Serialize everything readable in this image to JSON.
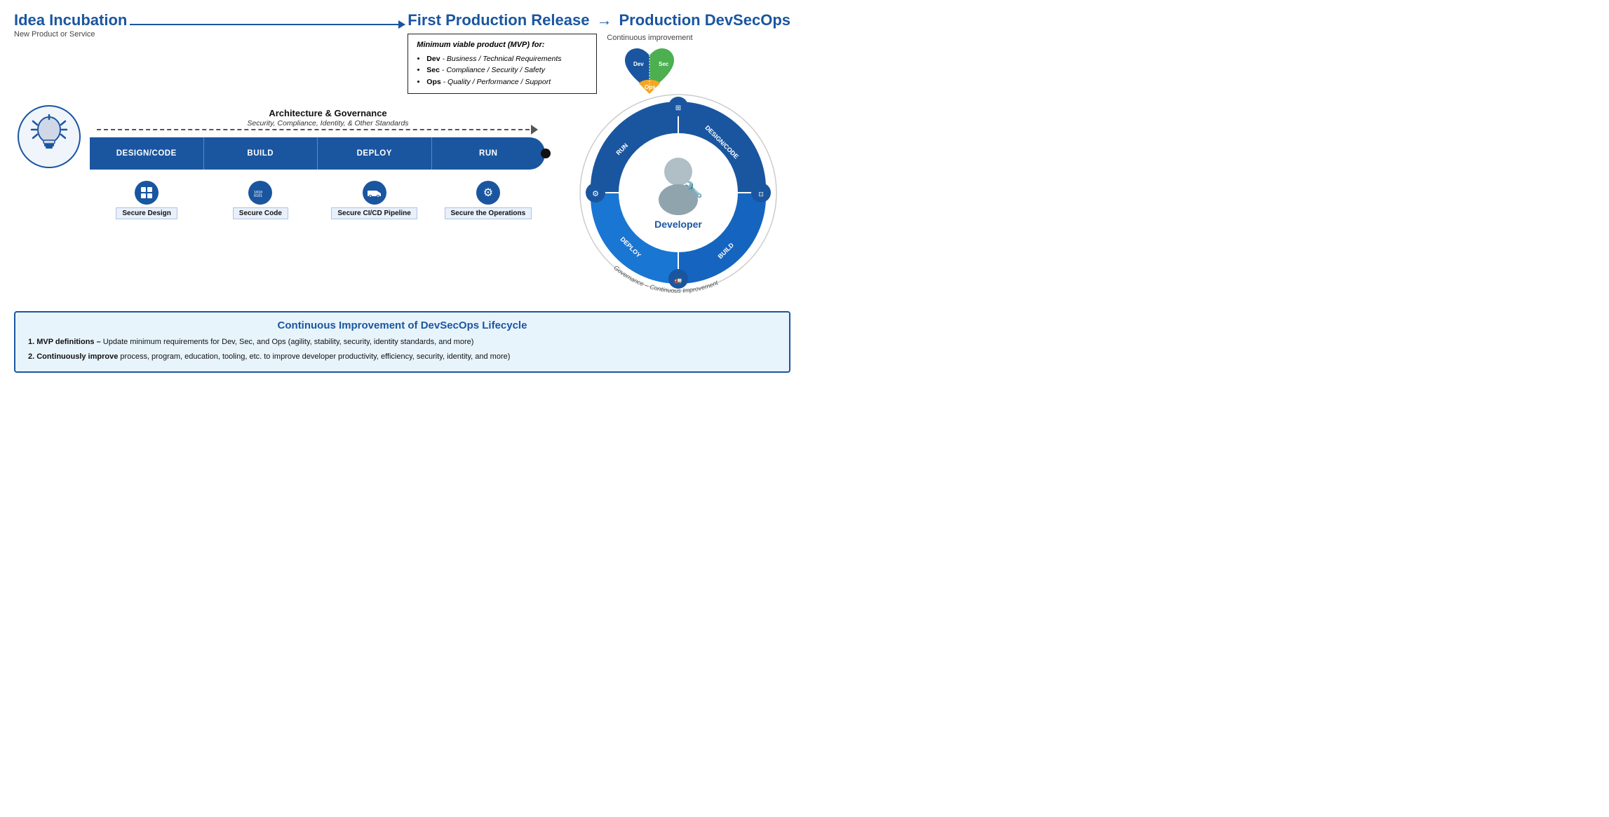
{
  "header": {
    "idea_title": "Idea Incubation",
    "idea_subtitle": "New Product or Service",
    "first_production": "First Production Release",
    "arrow": "→",
    "production_devsecops": "Production DevSecOps",
    "continuous_improvement": "Continuous improvement"
  },
  "mvp": {
    "title": "Minimum viable product (MVP) for:",
    "items": [
      {
        "label": "Dev",
        "desc": "Business / Technical Requirements"
      },
      {
        "label": "Sec",
        "desc": "Compliance / Security / Safety"
      },
      {
        "label": "Ops",
        "desc": "Quality / Performance / Support"
      }
    ]
  },
  "architecture": {
    "title": "Architecture & Governance",
    "subtitle": "Security, Compliance, Identity, & Other Standards"
  },
  "pipeline": {
    "stages": [
      "DESIGN/CODE",
      "BUILD",
      "DEPLOY",
      "RUN"
    ],
    "icons": [
      {
        "label": "Secure Design",
        "icon": "⊞"
      },
      {
        "label": "Secure Code",
        "icon": "⊞"
      },
      {
        "label": "Secure CI/CD Pipeline",
        "icon": "🚛"
      },
      {
        "label": "Secure the Operations",
        "icon": "⚙"
      }
    ]
  },
  "circle": {
    "stages": [
      "DESIGN/CODE",
      "BUILD",
      "DEPLOY",
      "RUN"
    ],
    "center_label": "Developer",
    "governance_label": "Governance – Continuous Improvement"
  },
  "bottom": {
    "title": "Continuous Improvement of DevSecOps Lifecycle",
    "point1_bold": "1.  MVP definitions –",
    "point1_text": " Update minimum requirements for Dev, Sec, and Ops (agility, stability, security, identity standards, and more)",
    "point2_bold": "2.  Continuously improve",
    "point2_text": " process, program, education, tooling, etc. to improve developer productivity, efficiency, security, identity, and more)"
  }
}
